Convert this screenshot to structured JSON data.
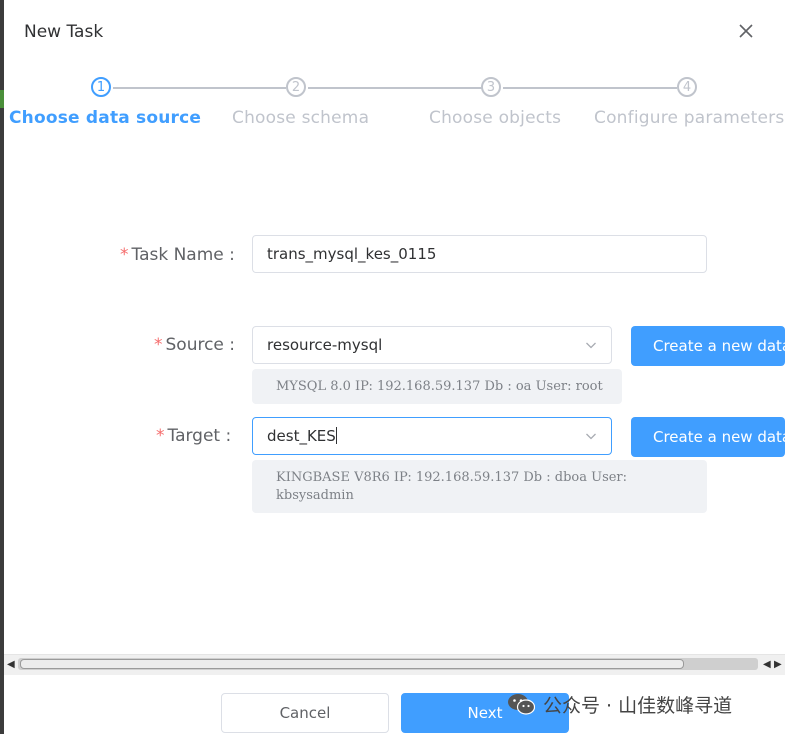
{
  "dialog": {
    "title": "New Task"
  },
  "steps": [
    {
      "number": "1",
      "label": "Choose data source",
      "active": true
    },
    {
      "number": "2",
      "label": "Choose schema",
      "active": false
    },
    {
      "number": "3",
      "label": "Choose objects",
      "active": false
    },
    {
      "number": "4",
      "label": "Configure parameters",
      "active": false
    }
  ],
  "form": {
    "required_mark": "*",
    "task_name": {
      "label": "Task Name :",
      "value": "trans_mysql_kes_0115"
    },
    "source": {
      "label": "Source :",
      "value": "resource-mysql",
      "info": "MYSQL 8.0 IP: 192.168.59.137 Db : oa User: root",
      "create_button": "Create a new data source"
    },
    "target": {
      "label": "Target :",
      "value": "dest_KES",
      "info": "KINGBASE V8R6 IP: 192.168.59.137 Db : dboa User: kbsysadmin",
      "create_button": "Create a new data source"
    }
  },
  "footer": {
    "cancel": "Cancel",
    "next": "Next"
  },
  "watermark": {
    "text": "公众号 · 山佳数峰寻道"
  },
  "colors": {
    "accent": "#409eff",
    "required": "#f56c6c",
    "inactive": "#c0c4cc"
  }
}
